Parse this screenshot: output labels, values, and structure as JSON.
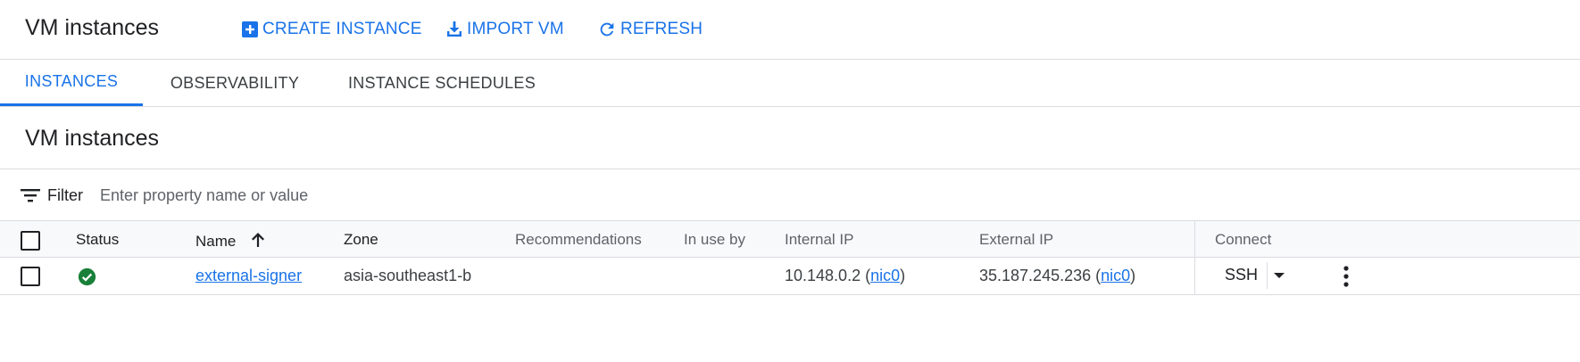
{
  "header": {
    "title": "VM instances",
    "create_label": "CREATE INSTANCE",
    "import_label": "IMPORT VM",
    "refresh_label": "REFRESH"
  },
  "tabs": [
    {
      "label": "INSTANCES",
      "active": true
    },
    {
      "label": "OBSERVABILITY",
      "active": false
    },
    {
      "label": "INSTANCE SCHEDULES",
      "active": false
    }
  ],
  "section": {
    "title": "VM instances"
  },
  "filter": {
    "label": "Filter",
    "placeholder": "Enter property name or value"
  },
  "table": {
    "columns": {
      "status": "Status",
      "name": "Name",
      "zone": "Zone",
      "recommendations": "Recommendations",
      "in_use_by": "In use by",
      "internal_ip": "Internal IP",
      "external_ip": "External IP",
      "connect": "Connect"
    },
    "rows": [
      {
        "status": "running",
        "name": "external-signer",
        "zone": "asia-southeast1-b",
        "recommendations": "",
        "in_use_by": "",
        "internal_ip": "10.148.0.2",
        "internal_nic": "nic0",
        "external_ip": "35.187.245.236",
        "external_nic": "nic0",
        "connect_label": "SSH"
      }
    ]
  },
  "colors": {
    "accent": "#1a73e8",
    "status_ok": "#188038"
  }
}
